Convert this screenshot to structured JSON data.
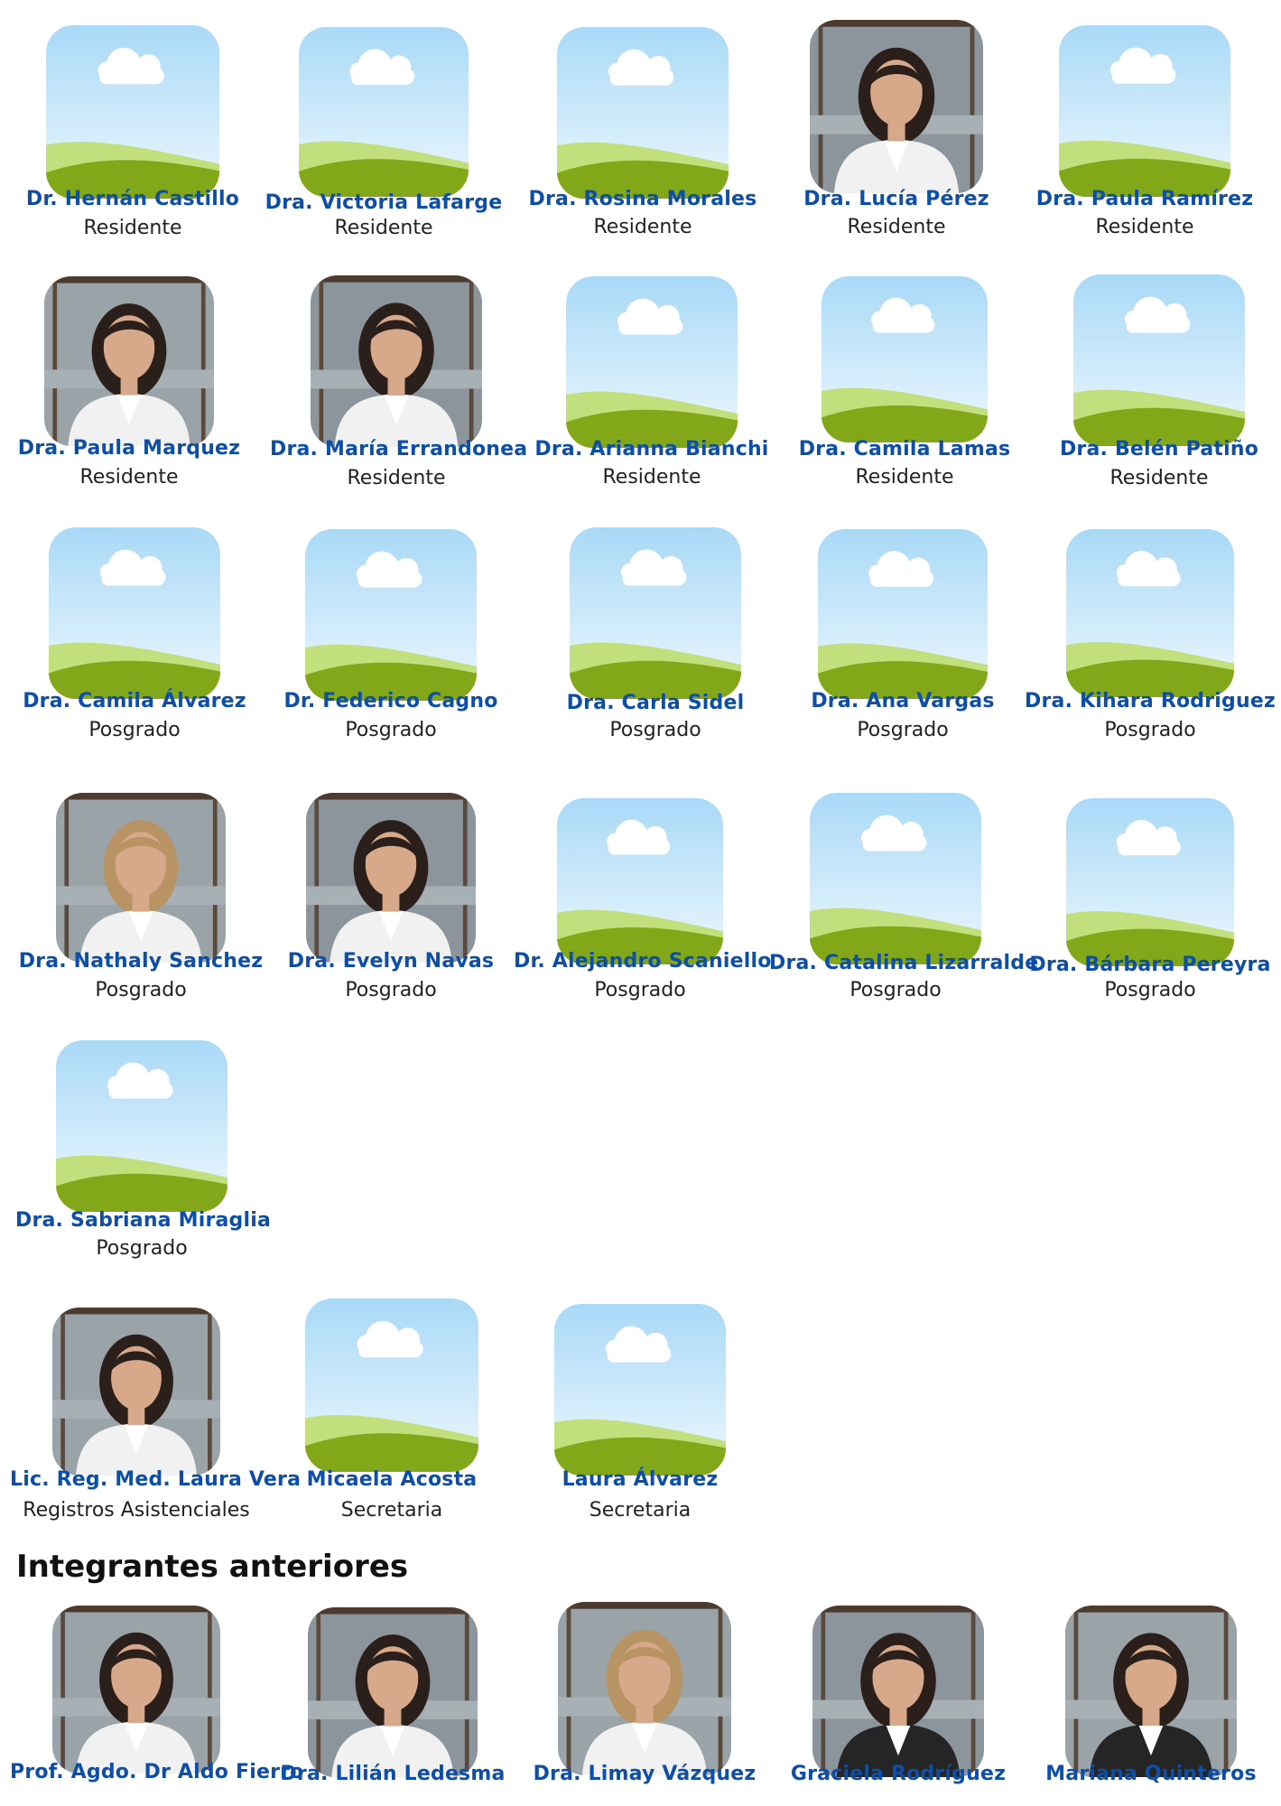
{
  "colors": {
    "name": "#0d4fa8",
    "role": "#222222",
    "sky_top": "#a9d9f7",
    "sky_bottom": "#eef8fd",
    "hill_light": "#c2df7e",
    "hill_dark": "#82a81a",
    "cloud": "#ffffff",
    "photo_bg": "#8c959b",
    "coat": "#f1f1f1",
    "dark_jacket": "#252525",
    "skin": "#d7a98a",
    "hair_dark": "#2a1f1a",
    "hair_light": "#b89464"
  },
  "members": [
    {
      "name": "Dr. Hernán Castillo",
      "role": "Residente",
      "photo": "placeholder"
    },
    {
      "name": "Dra. Victoria Lafarge",
      "role": "Residente",
      "photo": "placeholder"
    },
    {
      "name": "Dra. Rosina Morales",
      "role": "Residente",
      "photo": "placeholder"
    },
    {
      "name": "Dra. Lucía Pérez",
      "role": "Residente",
      "photo": "portrait"
    },
    {
      "name": "Dra. Paula Ramírez",
      "role": "Residente",
      "photo": "placeholder"
    },
    {
      "name": "Dra. Paula Marquez",
      "role": "Residente",
      "photo": "portrait"
    },
    {
      "name": "Dra. María Errandonea",
      "role": "Residente",
      "photo": "portrait"
    },
    {
      "name": "Dra. Arianna Bianchi",
      "role": "Residente",
      "photo": "placeholder"
    },
    {
      "name": "Dra. Camila Lamas",
      "role": "Residente",
      "photo": "placeholder"
    },
    {
      "name": "Dra. Belén Patiño",
      "role": "Residente",
      "photo": "placeholder"
    },
    {
      "name": "Dra. Camila Álvarez",
      "role": "Posgrado",
      "photo": "placeholder"
    },
    {
      "name": "Dr. Federico Cagno",
      "role": "Posgrado",
      "photo": "placeholder"
    },
    {
      "name": "Dra. Carla Sidel",
      "role": "Posgrado",
      "photo": "placeholder"
    },
    {
      "name": "Dra. Ana Vargas",
      "role": "Posgrado",
      "photo": "placeholder"
    },
    {
      "name": "Dra. Kihara Rodriguez",
      "role": "Posgrado",
      "photo": "placeholder"
    },
    {
      "name": "Dra. Nathaly Sanchez",
      "role": "Posgrado",
      "photo": "portrait"
    },
    {
      "name": "Dra. Evelyn Navas",
      "role": "Posgrado",
      "photo": "portrait"
    },
    {
      "name": "Dr. Alejandro Scaniello",
      "role": "Posgrado",
      "photo": "placeholder"
    },
    {
      "name": "Dra. Catalina Lizarralde",
      "role": "Posgrado",
      "photo": "placeholder"
    },
    {
      "name": "Dra. Bárbara Pereyra",
      "role": "Posgrado",
      "photo": "placeholder"
    },
    {
      "name": "Dra. Sabriana Miraglia",
      "role": "Posgrado",
      "photo": "placeholder"
    },
    {
      "name": "Lic. Reg. Med. Laura Vera",
      "role": "Registros Asistenciales",
      "photo": "portrait"
    },
    {
      "name": "Micaela Acosta",
      "role": "Secretaria",
      "photo": "placeholder"
    },
    {
      "name": "Laura Álvarez",
      "role": "Secretaria",
      "photo": "placeholder"
    }
  ],
  "former_section": {
    "title": "Integrantes anteriores",
    "members": [
      {
        "name": "Prof. Agdo. Dr Aldo Fierro",
        "photo": "portrait"
      },
      {
        "name": "Dra. Lilián Ledesma",
        "photo": "portrait"
      },
      {
        "name": "Dra. Limay Vázquez",
        "photo": "portrait"
      },
      {
        "name": "Graciela Rodríguez",
        "photo": "portrait"
      },
      {
        "name": "Mariana Quinteros",
        "photo": "portrait"
      }
    ]
  }
}
